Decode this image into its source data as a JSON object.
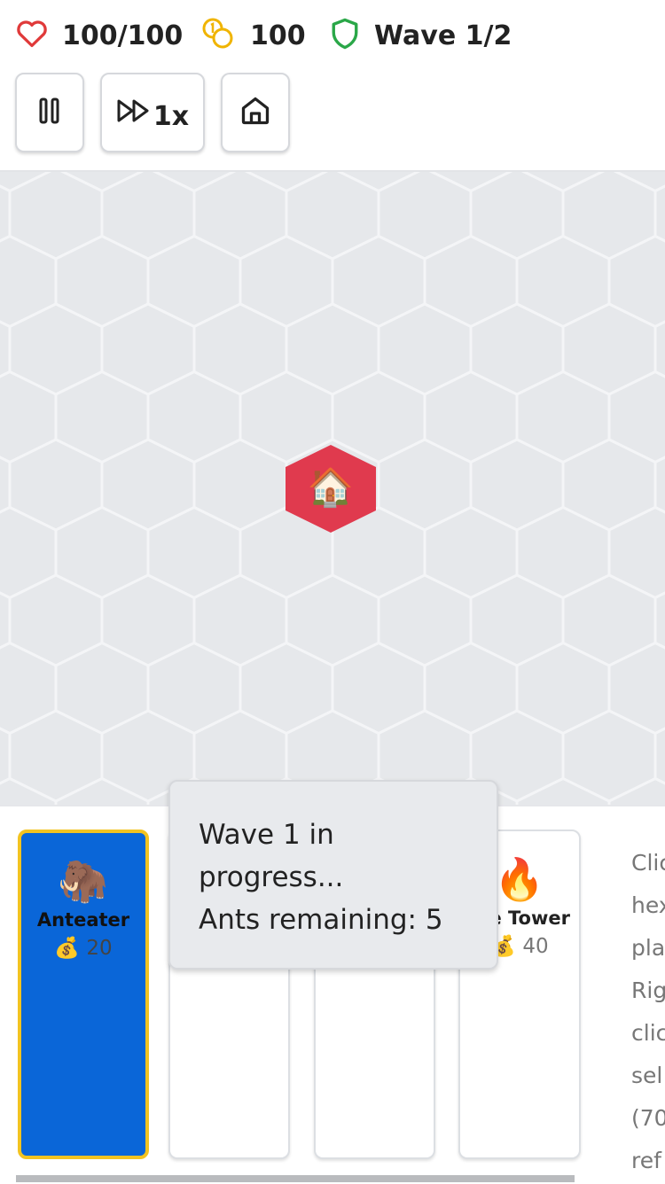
{
  "status": {
    "health": "100/100",
    "coins": "100",
    "wave": "Wave 1/2",
    "health_icon": "heart-icon",
    "coins_icon": "coins-icon",
    "wave_icon": "shield-icon",
    "colors": {
      "heart": "#e03a3a",
      "coins": "#f0b400",
      "shield": "#2aa748"
    }
  },
  "controls": {
    "pause_icon": "pause-icon",
    "speed_label": "1x",
    "speed_icon": "fast-forward-icon",
    "home_icon": "home-icon"
  },
  "board": {
    "base_icon": "🏠",
    "base_color": "#e03a4e",
    "tile_color": "#e6e8eb",
    "tile_border": "#f4f5f7"
  },
  "tooltip": {
    "line1": "Wave 1 in",
    "line2": "progress...",
    "line3": "Ants remaining: 5"
  },
  "towers": [
    {
      "emoji": "🦣",
      "name": "Anteater",
      "cost_icon": "💰",
      "cost": "20",
      "selected": true
    },
    {
      "emoji": "",
      "name": "",
      "cost_icon": "",
      "cost": ""
    },
    {
      "emoji": "",
      "name": "",
      "cost_icon": "",
      "cost": ""
    },
    {
      "emoji": "🔥",
      "name": "e Tower",
      "cost_icon": "💰",
      "cost": "40"
    }
  ],
  "help_text": [
    "Clic",
    "hex",
    "pla",
    "Rig",
    "clic",
    "sel",
    "(70",
    "ref"
  ],
  "colors": {
    "selected_card": "#0a66d8",
    "selected_border": "#f3c320"
  }
}
